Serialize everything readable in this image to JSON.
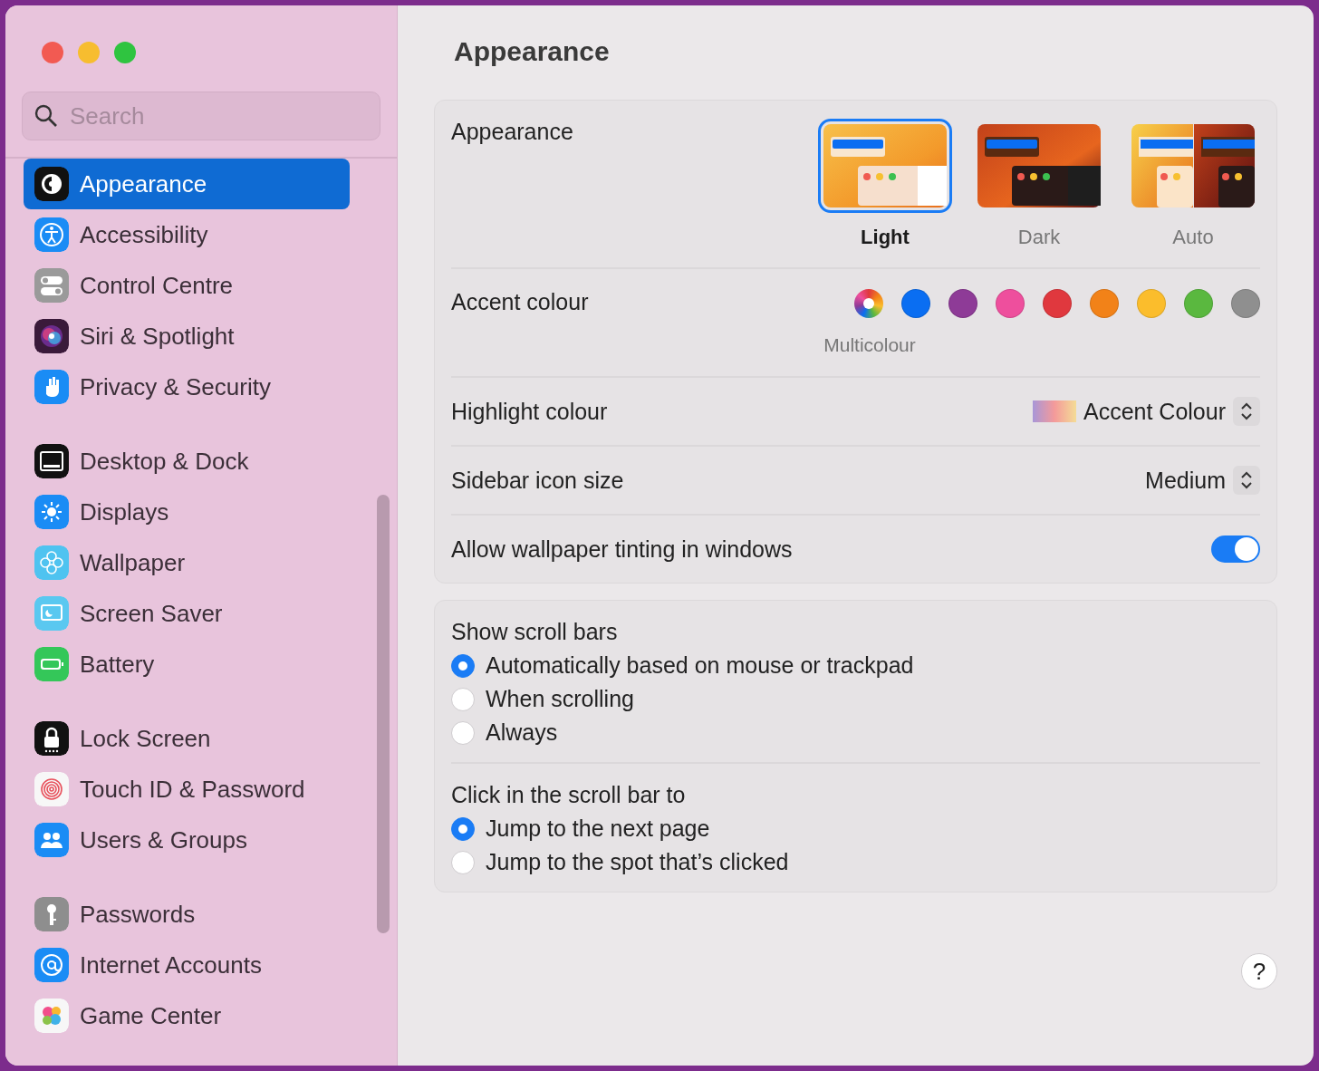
{
  "sidebar": {
    "search": {
      "placeholder": "Search"
    },
    "groups": [
      [
        {
          "label": "Appearance",
          "selected": true
        },
        {
          "label": "Accessibility",
          "selected": false
        },
        {
          "label": "Control Centre",
          "selected": false
        },
        {
          "label": "Siri & Spotlight",
          "selected": false
        },
        {
          "label": "Privacy & Security",
          "selected": false
        }
      ],
      [
        {
          "label": "Desktop & Dock",
          "selected": false
        },
        {
          "label": "Displays",
          "selected": false
        },
        {
          "label": "Wallpaper",
          "selected": false
        },
        {
          "label": "Screen Saver",
          "selected": false
        },
        {
          "label": "Battery",
          "selected": false
        }
      ],
      [
        {
          "label": "Lock Screen",
          "selected": false
        },
        {
          "label": "Touch ID & Password",
          "selected": false
        },
        {
          "label": "Users & Groups",
          "selected": false
        }
      ],
      [
        {
          "label": "Passwords",
          "selected": false
        },
        {
          "label": "Internet Accounts",
          "selected": false
        },
        {
          "label": "Game Center",
          "selected": false
        }
      ]
    ]
  },
  "page_title": "Appearance",
  "appearance": {
    "label": "Appearance",
    "options": [
      {
        "kind": "light",
        "label": "Light",
        "selected": true
      },
      {
        "kind": "dark",
        "label": "Dark",
        "selected": false
      },
      {
        "kind": "auto",
        "label": "Auto",
        "selected": false
      }
    ]
  },
  "accent": {
    "label": "Accent colour",
    "caption": "Multicolour",
    "colors": [
      {
        "kind": "multi",
        "selected": true
      },
      {
        "kind": "solid",
        "color": "#0a6ef2",
        "selected": false
      },
      {
        "kind": "solid",
        "color": "#8e3b97",
        "selected": false
      },
      {
        "kind": "solid",
        "color": "#ee4f9d",
        "selected": false
      },
      {
        "kind": "solid",
        "color": "#e0383e",
        "selected": false
      },
      {
        "kind": "solid",
        "color": "#f28218",
        "selected": false
      },
      {
        "kind": "solid",
        "color": "#fbbd2c",
        "selected": false
      },
      {
        "kind": "solid",
        "color": "#5ab83f",
        "selected": false
      },
      {
        "kind": "solid",
        "color": "#8f8f8f",
        "selected": false
      }
    ]
  },
  "highlight": {
    "label": "Highlight colour",
    "value": "Accent Colour"
  },
  "sidebar_icon_size": {
    "label": "Sidebar icon size",
    "value": "Medium"
  },
  "wallpaper_tinting": {
    "label": "Allow wallpaper tinting in windows",
    "on": true
  },
  "scroll_bars": {
    "label": "Show scroll bars",
    "options": [
      {
        "label": "Automatically based on mouse or trackpad",
        "selected": true
      },
      {
        "label": "When scrolling",
        "selected": false
      },
      {
        "label": "Always",
        "selected": false
      }
    ]
  },
  "click_scroll": {
    "label": "Click in the scroll bar to",
    "options": [
      {
        "label": "Jump to the next page",
        "selected": true
      },
      {
        "label": "Jump to the spot that’s clicked",
        "selected": false
      }
    ]
  },
  "help": "?"
}
